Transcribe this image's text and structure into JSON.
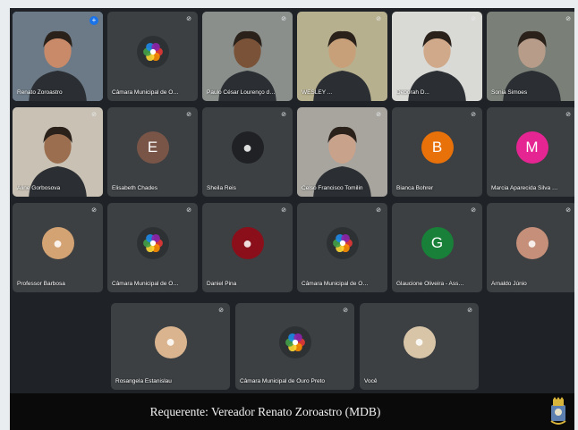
{
  "caption": "Requerente: Vereador Renato Zoroastro (MDB)",
  "participants": [
    {
      "name": "Renato Zoroastro",
      "kind": "video",
      "bg": "#6b7a86",
      "skin": "#c98a6a",
      "active": true
    },
    {
      "name": "Câmara Municipal de Ouro...",
      "kind": "logo"
    },
    {
      "name": "Paulo César Lourenço de...",
      "kind": "video",
      "bg": "#8a8f8c",
      "skin": "#7a5238"
    },
    {
      "name": "WESLEY ...",
      "kind": "video",
      "bg": "#b7b08e",
      "skin": "#c7a07a"
    },
    {
      "name": "Deborah D...",
      "kind": "video",
      "bg": "#d9d9d5",
      "skin": "#d0a88a"
    },
    {
      "name": "Sonia Simoes",
      "kind": "video",
      "bg": "#7a8077",
      "skin": "#b89c8a"
    },
    {
      "name": "Aline Gorbosova",
      "kind": "video",
      "bg": "#c9c2b4",
      "skin": "#9b6e50"
    },
    {
      "name": "Elisabeth Chades",
      "kind": "letter",
      "letter": "E",
      "color": "#795548"
    },
    {
      "name": "Sheila Reis",
      "kind": "photo",
      "color": "#202124"
    },
    {
      "name": "Celso Francisco Tomilin",
      "kind": "video",
      "bg": "#a7a59e",
      "skin": "#c9a28c"
    },
    {
      "name": "Bianca Bohrer",
      "kind": "letter",
      "letter": "B",
      "color": "#e8710a"
    },
    {
      "name": "Marcia Aparecida Silva San...",
      "kind": "letter",
      "letter": "M",
      "color": "#e52592"
    },
    {
      "name": "Professor Barbosa",
      "kind": "photo",
      "color": "#d4a373"
    },
    {
      "name": "Câmara Municipal de Ouro...",
      "kind": "logo"
    },
    {
      "name": "Daniel Pina",
      "kind": "photo",
      "color": "#8b0f1a"
    },
    {
      "name": "Câmara Municipal de Ouro...",
      "kind": "logo"
    },
    {
      "name": "Glaucione Oliveira - Asses...",
      "kind": "letter",
      "letter": "G",
      "color": "#188038"
    },
    {
      "name": "Arnaldo Júnio",
      "kind": "photo",
      "color": "#c58f7a"
    },
    {
      "name": "Rosangela Estanislau",
      "kind": "photo",
      "color": "#d9b48f"
    },
    {
      "name": "Câmara Municipal de Ouro Preto",
      "kind": "logo"
    },
    {
      "name": "Você",
      "kind": "photo",
      "color": "#d8c5a8"
    }
  ],
  "icons": {
    "mic": "mic-off-icon",
    "pin": "pin-icon",
    "emblem": "city-emblem-icon"
  },
  "colors": {
    "tile": "#3c4043",
    "background": "#1f2226",
    "caption_bar": "#0a0a0a",
    "active_outline": "#8ab4f8"
  }
}
